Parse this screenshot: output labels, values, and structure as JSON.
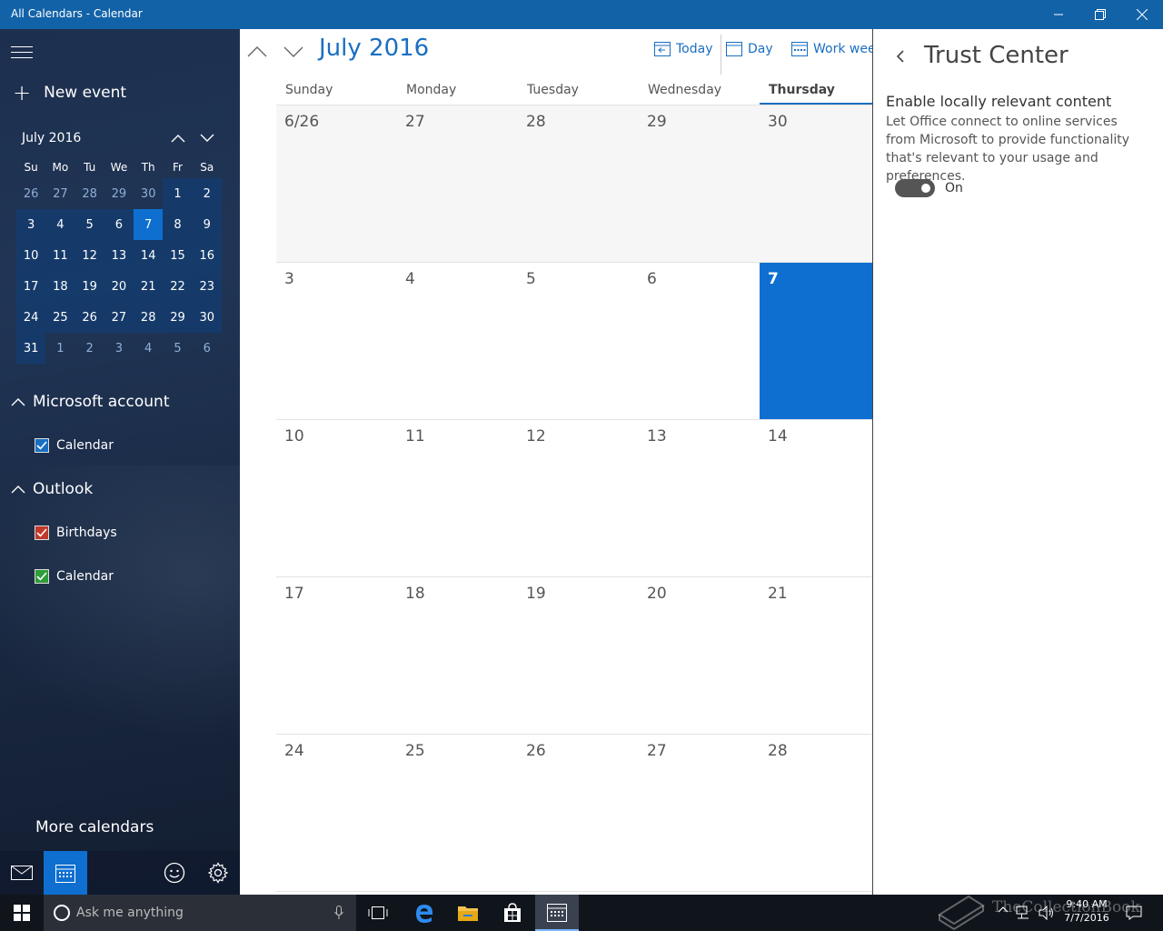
{
  "window": {
    "title": "All Calendars - Calendar"
  },
  "sidebar": {
    "new_event": "New event",
    "mini_month_label": "July 2016",
    "weekdays": [
      "Su",
      "Mo",
      "Tu",
      "We",
      "Th",
      "Fr",
      "Sa"
    ],
    "weeks": [
      [
        "26",
        "27",
        "28",
        "29",
        "30",
        "1",
        "2"
      ],
      [
        "3",
        "4",
        "5",
        "6",
        "7",
        "8",
        "9"
      ],
      [
        "10",
        "11",
        "12",
        "13",
        "14",
        "15",
        "16"
      ],
      [
        "17",
        "18",
        "19",
        "20",
        "21",
        "22",
        "23"
      ],
      [
        "24",
        "25",
        "26",
        "27",
        "28",
        "29",
        "30"
      ],
      [
        "31",
        "1",
        "2",
        "3",
        "4",
        "5",
        "6"
      ]
    ],
    "groups": [
      {
        "name": "Microsoft account",
        "calendars": [
          {
            "label": "Calendar",
            "color": "#1a6fc0"
          }
        ]
      },
      {
        "name": "Outlook",
        "calendars": [
          {
            "label": "Birthdays",
            "color": "#c0392b"
          },
          {
            "label": "Calendar",
            "color": "#2e9d3a"
          }
        ]
      }
    ],
    "more_calendars": "More calendars"
  },
  "main": {
    "month_title": "July 2016",
    "views": {
      "today": "Today",
      "day": "Day",
      "work_week": "Work week"
    },
    "days_of_week": [
      "Sunday",
      "Monday",
      "Tuesday",
      "Wednesday",
      "Thursday"
    ],
    "weeks": [
      [
        "6/26",
        "27",
        "28",
        "29",
        "30"
      ],
      [
        "3",
        "4",
        "5",
        "6",
        "7"
      ],
      [
        "10",
        "11",
        "12",
        "13",
        "14"
      ],
      [
        "17",
        "18",
        "19",
        "20",
        "21"
      ],
      [
        "24",
        "25",
        "26",
        "27",
        "28"
      ]
    ],
    "today_date": "7"
  },
  "trust_center": {
    "title": "Trust Center",
    "setting_title": "Enable locally relevant content",
    "description": "Let Office connect to online services from Microsoft to provide functionality that's relevant to your usage and preferences.",
    "toggle_state": "On"
  },
  "taskbar": {
    "search_placeholder": "Ask me anything",
    "time": "9:40 AM",
    "date": "7/7/2016",
    "watermark": "TheCollectionBook"
  },
  "colors": {
    "accent": "#0e6fd0",
    "titlebar": "#1262a8",
    "taskbar": "#10151c"
  }
}
